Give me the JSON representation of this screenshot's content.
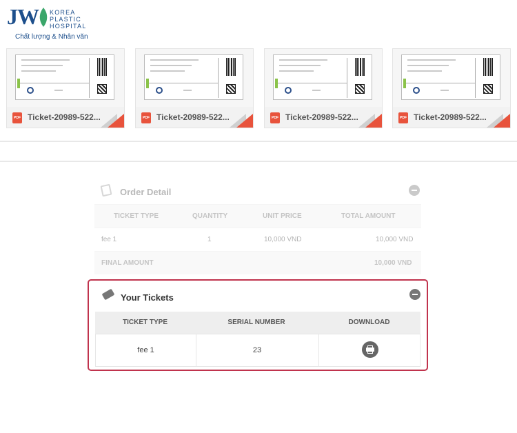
{
  "logo": {
    "mark": "JW",
    "line1": "KOREA",
    "line2": "PLASTIC",
    "line3": "HOSPITAL",
    "slogan": "Chất lượng & Nhân văn",
    "brand_color": "#1d4f8c"
  },
  "files": [
    {
      "name": "Ticket-20989-522...",
      "type_badge": "PDF"
    },
    {
      "name": "Ticket-20989-522...",
      "type_badge": "PDF"
    },
    {
      "name": "Ticket-20989-522...",
      "type_badge": "PDF"
    },
    {
      "name": "Ticket-20989-522...",
      "type_badge": "PDF"
    }
  ],
  "order_detail": {
    "title": "Order Detail",
    "headers": [
      "TICKET TYPE",
      "QUANTITY",
      "UNIT PRICE",
      "TOTAL AMOUNT"
    ],
    "rows": [
      {
        "ticket_type": "fee 1",
        "quantity": "1",
        "unit_price": "10,000 VND",
        "total_amount": "10,000 VND"
      }
    ],
    "final_label": "FINAL AMOUNT",
    "final_value": "10,000 VND"
  },
  "your_tickets": {
    "title": "Your Tickets",
    "headers": [
      "TICKET TYPE",
      "SERIAL NUMBER",
      "DOWNLOAD"
    ],
    "rows": [
      {
        "ticket_type": "fee 1",
        "serial_number": "23"
      }
    ],
    "highlight_color": "#c0334d"
  }
}
